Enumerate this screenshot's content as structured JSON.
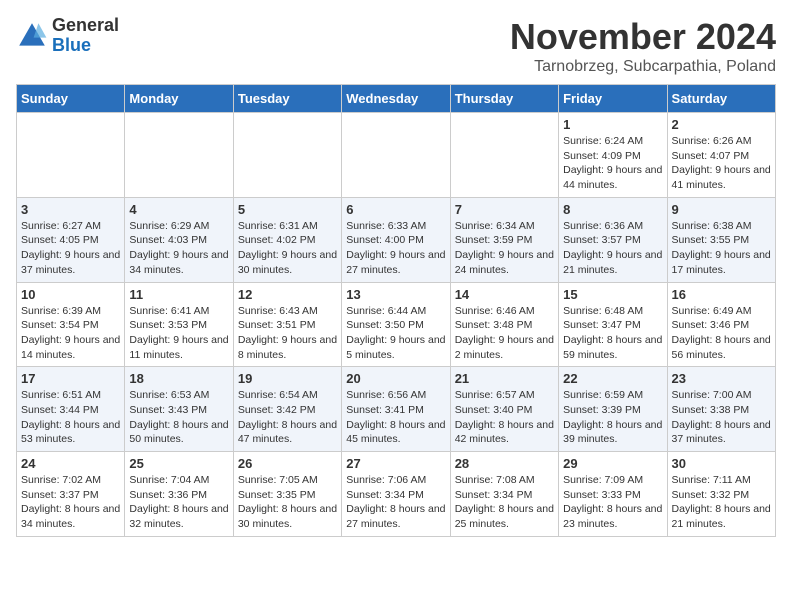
{
  "logo": {
    "general": "General",
    "blue": "Blue"
  },
  "header": {
    "month": "November 2024",
    "location": "Tarnobrzeg, Subcarpathia, Poland"
  },
  "weekdays": [
    "Sunday",
    "Monday",
    "Tuesday",
    "Wednesday",
    "Thursday",
    "Friday",
    "Saturday"
  ],
  "weeks": [
    [
      {
        "day": "",
        "detail": ""
      },
      {
        "day": "",
        "detail": ""
      },
      {
        "day": "",
        "detail": ""
      },
      {
        "day": "",
        "detail": ""
      },
      {
        "day": "",
        "detail": ""
      },
      {
        "day": "1",
        "detail": "Sunrise: 6:24 AM\nSunset: 4:09 PM\nDaylight: 9 hours and 44 minutes."
      },
      {
        "day": "2",
        "detail": "Sunrise: 6:26 AM\nSunset: 4:07 PM\nDaylight: 9 hours and 41 minutes."
      }
    ],
    [
      {
        "day": "3",
        "detail": "Sunrise: 6:27 AM\nSunset: 4:05 PM\nDaylight: 9 hours and 37 minutes."
      },
      {
        "day": "4",
        "detail": "Sunrise: 6:29 AM\nSunset: 4:03 PM\nDaylight: 9 hours and 34 minutes."
      },
      {
        "day": "5",
        "detail": "Sunrise: 6:31 AM\nSunset: 4:02 PM\nDaylight: 9 hours and 30 minutes."
      },
      {
        "day": "6",
        "detail": "Sunrise: 6:33 AM\nSunset: 4:00 PM\nDaylight: 9 hours and 27 minutes."
      },
      {
        "day": "7",
        "detail": "Sunrise: 6:34 AM\nSunset: 3:59 PM\nDaylight: 9 hours and 24 minutes."
      },
      {
        "day": "8",
        "detail": "Sunrise: 6:36 AM\nSunset: 3:57 PM\nDaylight: 9 hours and 21 minutes."
      },
      {
        "day": "9",
        "detail": "Sunrise: 6:38 AM\nSunset: 3:55 PM\nDaylight: 9 hours and 17 minutes."
      }
    ],
    [
      {
        "day": "10",
        "detail": "Sunrise: 6:39 AM\nSunset: 3:54 PM\nDaylight: 9 hours and 14 minutes."
      },
      {
        "day": "11",
        "detail": "Sunrise: 6:41 AM\nSunset: 3:53 PM\nDaylight: 9 hours and 11 minutes."
      },
      {
        "day": "12",
        "detail": "Sunrise: 6:43 AM\nSunset: 3:51 PM\nDaylight: 9 hours and 8 minutes."
      },
      {
        "day": "13",
        "detail": "Sunrise: 6:44 AM\nSunset: 3:50 PM\nDaylight: 9 hours and 5 minutes."
      },
      {
        "day": "14",
        "detail": "Sunrise: 6:46 AM\nSunset: 3:48 PM\nDaylight: 9 hours and 2 minutes."
      },
      {
        "day": "15",
        "detail": "Sunrise: 6:48 AM\nSunset: 3:47 PM\nDaylight: 8 hours and 59 minutes."
      },
      {
        "day": "16",
        "detail": "Sunrise: 6:49 AM\nSunset: 3:46 PM\nDaylight: 8 hours and 56 minutes."
      }
    ],
    [
      {
        "day": "17",
        "detail": "Sunrise: 6:51 AM\nSunset: 3:44 PM\nDaylight: 8 hours and 53 minutes."
      },
      {
        "day": "18",
        "detail": "Sunrise: 6:53 AM\nSunset: 3:43 PM\nDaylight: 8 hours and 50 minutes."
      },
      {
        "day": "19",
        "detail": "Sunrise: 6:54 AM\nSunset: 3:42 PM\nDaylight: 8 hours and 47 minutes."
      },
      {
        "day": "20",
        "detail": "Sunrise: 6:56 AM\nSunset: 3:41 PM\nDaylight: 8 hours and 45 minutes."
      },
      {
        "day": "21",
        "detail": "Sunrise: 6:57 AM\nSunset: 3:40 PM\nDaylight: 8 hours and 42 minutes."
      },
      {
        "day": "22",
        "detail": "Sunrise: 6:59 AM\nSunset: 3:39 PM\nDaylight: 8 hours and 39 minutes."
      },
      {
        "day": "23",
        "detail": "Sunrise: 7:00 AM\nSunset: 3:38 PM\nDaylight: 8 hours and 37 minutes."
      }
    ],
    [
      {
        "day": "24",
        "detail": "Sunrise: 7:02 AM\nSunset: 3:37 PM\nDaylight: 8 hours and 34 minutes."
      },
      {
        "day": "25",
        "detail": "Sunrise: 7:04 AM\nSunset: 3:36 PM\nDaylight: 8 hours and 32 minutes."
      },
      {
        "day": "26",
        "detail": "Sunrise: 7:05 AM\nSunset: 3:35 PM\nDaylight: 8 hours and 30 minutes."
      },
      {
        "day": "27",
        "detail": "Sunrise: 7:06 AM\nSunset: 3:34 PM\nDaylight: 8 hours and 27 minutes."
      },
      {
        "day": "28",
        "detail": "Sunrise: 7:08 AM\nSunset: 3:34 PM\nDaylight: 8 hours and 25 minutes."
      },
      {
        "day": "29",
        "detail": "Sunrise: 7:09 AM\nSunset: 3:33 PM\nDaylight: 8 hours and 23 minutes."
      },
      {
        "day": "30",
        "detail": "Sunrise: 7:11 AM\nSunset: 3:32 PM\nDaylight: 8 hours and 21 minutes."
      }
    ]
  ]
}
